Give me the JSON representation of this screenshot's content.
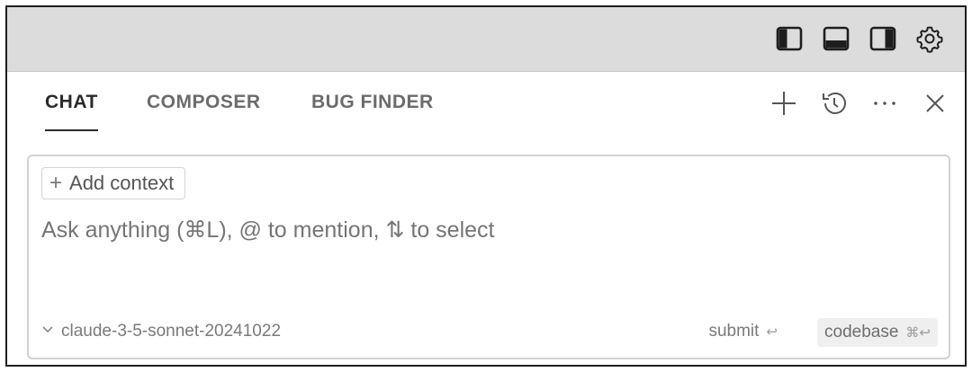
{
  "titlebar": {
    "icons": [
      "sidebar-left-icon",
      "panel-bottom-icon",
      "sidebar-right-icon",
      "gear-icon"
    ]
  },
  "tabs": [
    {
      "label": "CHAT",
      "active": true
    },
    {
      "label": "COMPOSER",
      "active": false
    },
    {
      "label": "BUG FINDER",
      "active": false
    }
  ],
  "tab_actions": {
    "icons": [
      "plus-icon",
      "history-icon",
      "more-icon",
      "close-icon"
    ],
    "more_glyph": "···",
    "close_glyph": "✕",
    "plus_glyph": "+"
  },
  "composer": {
    "add_context_label": "Add context",
    "add_context_glyph": "+",
    "placeholder": "Ask anything (⌘L), @ to mention, ⇅ to select",
    "model_chevron": "⌄",
    "model_name": "claude-3-5-sonnet-20241022",
    "submit_label": "submit",
    "submit_kbd": "↩",
    "codebase_label": "codebase",
    "codebase_kbd": "⌘↩"
  }
}
